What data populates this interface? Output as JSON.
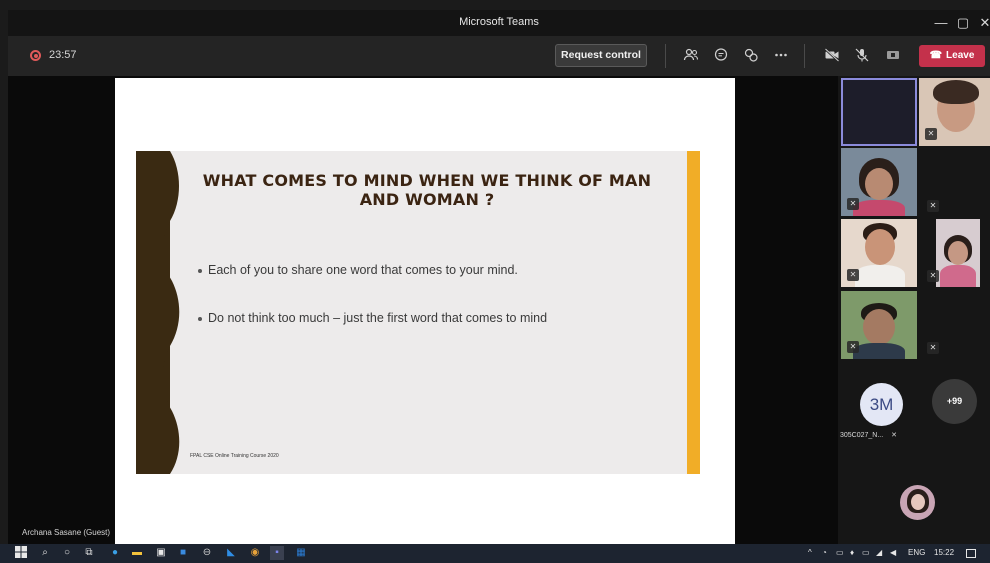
{
  "window": {
    "title": "Microsoft Teams",
    "controls": [
      "—",
      "▢",
      "✕"
    ]
  },
  "meeting": {
    "duration": "23:57",
    "request_control_label": "Request control",
    "leave_label": "Leave",
    "toolbar_icons": [
      "people-icon",
      "chat-icon",
      "reactions-icon",
      "more-icon",
      "camera-off-icon",
      "mic-off-icon",
      "share-tray-icon"
    ]
  },
  "slide": {
    "title": "WHAT COMES TO MIND WHEN WE THINK OF MAN AND WOMAN ?",
    "bullets": [
      "Each of you to share one word that comes to your mind.",
      "Do not think too much – just the first word that comes to mind"
    ],
    "footer": "FPAL CSE Online Training Course 2020",
    "colors": {
      "band": "#3a2a12",
      "accent_bar": "#f1ad27",
      "title": "#3b2412"
    }
  },
  "presenter": {
    "name": "Archana Sasane (Guest)"
  },
  "gallery": {
    "overflow_avatar": {
      "initials": "3M",
      "name": "305C027_N..."
    },
    "more_count": "+99"
  },
  "taskbar": {
    "language": "ENG",
    "time": "15:22"
  }
}
